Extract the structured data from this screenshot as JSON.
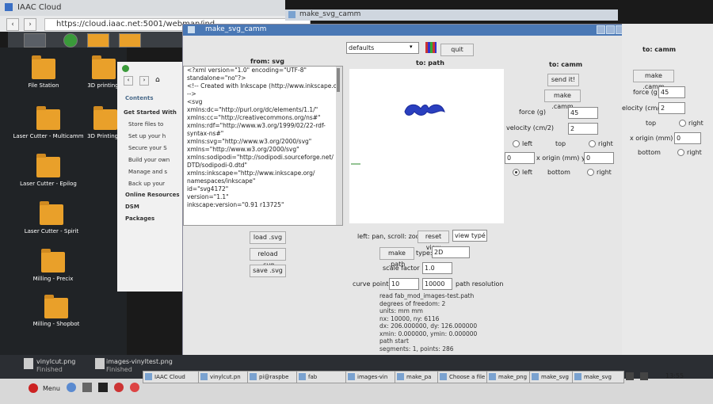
{
  "browser": {
    "title": "IAAC Cloud",
    "url": "https://cloud.iaac.net:5001/webman/ind"
  },
  "desktop": {
    "icons": [
      {
        "label": "File Station"
      },
      {
        "label": "3D printing"
      },
      {
        "label": "Laser Cutter - Multicamm"
      },
      {
        "label": "3D Printing -"
      },
      {
        "label": "Laser Cutter - Epilog"
      },
      {
        "label": "Laser Cutter - Spirit"
      },
      {
        "label": "Milling - Precix"
      },
      {
        "label": "Milling - Shopbot"
      }
    ]
  },
  "help_panel": {
    "heading": "Contents",
    "items": [
      "Get Started With",
      "Store files to",
      "Set up your h",
      "Secure your S",
      "Build your own",
      "Manage and s",
      "Back up your",
      "Online Resources",
      "DSM",
      "Packages"
    ]
  },
  "main_window": {
    "title": "make_svg_camm",
    "top_tab_title": "make_svg_camm",
    "defaults_select": "defaults",
    "quit": "quit",
    "from_label": "from: svg",
    "to_path_label": "to: path",
    "to_camm_label": "to: camm",
    "svg_lines": [
      "<?xml version=\"1.0\" encoding=\"UTF-8\"",
      "standalone=\"no\"?>",
      "<!-- Created with Inkscape (http://www.inkscape.org/)",
      "-->",
      "",
      "<svg",
      "  xmlns:dc=\"http://purl.org/dc/elements/1.1/\"",
      "  xmlns:cc=\"http://creativecommons.org/ns#\"",
      "  xmlns:rdf=\"http://www.w3.org/1999/02/22-rdf-",
      "syntax-ns#\"",
      "  xmlns:svg=\"http://www.w3.org/2000/svg\"",
      "  xmlns=\"http://www.w3.org/2000/svg\"",
      "  xmlns:sodipodi=\"http://sodipodi.sourceforge.net/",
      "DTD/sodipodi-0.dtd\"",
      "  xmlns:inkscape=\"http://www.inkscape.org/",
      "namespaces/inkscape\"",
      "  id=\"svg4172\"",
      "  version=\"1.1\"",
      "  inkscape:version=\"0.91 r13725\""
    ],
    "load_svg": "load .svg",
    "reload_svg": "reload .svg",
    "save_svg": "save .svg",
    "hint": "left: pan, scroll: zoom",
    "reset_view": "reset view",
    "view_type": "view typé",
    "make_path": "make .path",
    "type_label": "type:",
    "type_value": "2D",
    "scale_factor_label": "scale factor",
    "scale_factor": "1.0",
    "curve_points_label": "curve points",
    "curve_points": "10",
    "path_resolution": "10000",
    "path_resolution_label": "path resolution",
    "info": [
      "read fab_mod_images-test.path",
      "  degrees of freedom: 2",
      "  units: mm mm",
      "  nx: 10000, ny: 6116",
      "  dx: 206.000000, dy: 126.000000",
      "  xmin: 0.000000, ymin: 0.000000",
      "  path start",
      "  segments: 1, points: 286"
    ],
    "send_it": "send it!",
    "make_camm": "make .camm",
    "force_label": "force (g)",
    "force": "45",
    "velocity_label": "velocity (cm/2)",
    "velocity": "2",
    "left": "left",
    "top": "top",
    "right": "right",
    "origin_x": "0",
    "origin_label": "x  origin (mm)  y",
    "origin_y": "0",
    "bottom": "bottom"
  },
  "right_window": {
    "to_camm": "to: camm",
    "make_camm": "make .camm",
    "force_label": "force (g)",
    "force": "45",
    "velocity_label": "elocity (cm/2)",
    "velocity": "2",
    "top": "top",
    "right": "right",
    "origin_label": "x  origin (mm)  y",
    "origin_y": "0",
    "bottom": "bottom"
  },
  "taskbar_top": {
    "items": [
      {
        "name": "vinylcut.png",
        "status": "Finished"
      },
      {
        "name": "images-vinyltest.png",
        "status": "Finished"
      }
    ]
  },
  "taskbar": {
    "menu": "Menu",
    "tasks": [
      "IAAC Cloud",
      "vinylcut.pn",
      "pi@raspbe",
      "fab",
      "images-vin",
      "make_pa",
      "Choose a file",
      "make_png",
      "make_svg",
      "make_svg"
    ],
    "clock": "13:55"
  },
  "colors": {
    "titlebar": "#4a78b5",
    "mustache": "#2a3fbf",
    "folder": "#e9a02a"
  }
}
